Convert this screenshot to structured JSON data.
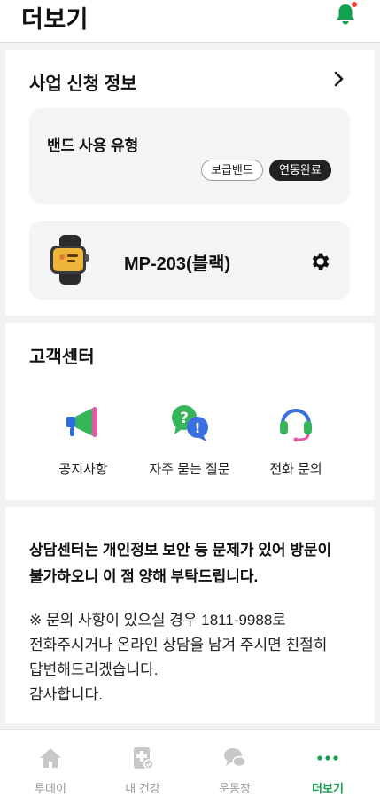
{
  "header": {
    "title": "더보기"
  },
  "business": {
    "title": "사업 신청 정보",
    "band_type_label": "밴드 사용 유형",
    "chips": [
      "보급밴드",
      "연동완료"
    ],
    "device_name": "MP-203(블랙)"
  },
  "customer_center": {
    "title": "고객센터",
    "items": [
      {
        "label": "공지사항",
        "icon": "megaphone-icon"
      },
      {
        "label": "자주 묻는 질문",
        "icon": "faq-bubbles-icon"
      },
      {
        "label": "전화 문의",
        "icon": "headset-icon"
      }
    ]
  },
  "notice": {
    "bold_line1": "상담센터는 개인정보 보안 등 문제가 있어 방문이",
    "bold_line2": "불가하오니 이 점 양해 부탁드립니다.",
    "body_line1": "※ 문의 사항이 있으실 경우 1811-9988로",
    "body_line2": "전화주시거나 온라인 상담을 남겨 주시면 친절히",
    "body_line3": "답변해드리겠습니다.",
    "body_line4": "감사합니다."
  },
  "tabbar": {
    "items": [
      {
        "label": "투데이",
        "icon": "home-icon",
        "active": false
      },
      {
        "label": "내 건강",
        "icon": "health-doc-icon",
        "active": false
      },
      {
        "label": "운동장",
        "icon": "chat-bubbles-icon",
        "active": false
      },
      {
        "label": "더보기",
        "icon": "more-dots-icon",
        "active": true
      }
    ]
  },
  "colors": {
    "accent": "#12a150",
    "badge": "#ff3b30",
    "chip_dark": "#222222"
  }
}
